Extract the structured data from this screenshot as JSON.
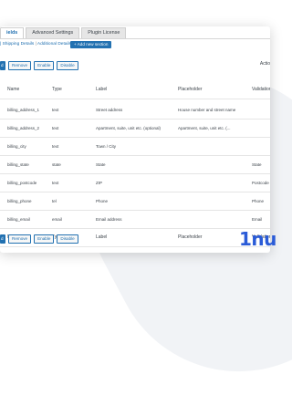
{
  "tabs": [
    {
      "label": "ields",
      "active": true
    },
    {
      "label": "Advanced Settings",
      "active": false
    },
    {
      "label": "Plugin License",
      "active": false
    }
  ],
  "subnav": {
    "shipping": "| Shipping Details",
    "sep": "|",
    "additional": "Additional Details"
  },
  "add_new": "+ Add new section",
  "toolbar": {
    "primary_label": "d",
    "remove": "Remove",
    "enable": "Enable",
    "disable": "Disable",
    "actions": "Actio"
  },
  "columns": {
    "name": "Name",
    "type": "Type",
    "label": "Label",
    "placeholder": "Placeholder",
    "validations": "Validations"
  },
  "rows": [
    {
      "name": "billing_address_1",
      "type": "text",
      "label": "Street address",
      "placeholder": "House number and street name",
      "validations": ""
    },
    {
      "name": "billing_address_2",
      "type": "text",
      "label": "Apartment, suite, unit etc. (optional)",
      "placeholder": "Apartment, suite, unit etc. (...",
      "validations": ""
    },
    {
      "name": "billing_city",
      "type": "text",
      "label": "Town / City",
      "placeholder": "",
      "validations": ""
    },
    {
      "name": "billing_state",
      "type": "state",
      "label": "State",
      "placeholder": "",
      "validations": "State"
    },
    {
      "name": "billing_postcode",
      "type": "text",
      "label": "ZIP",
      "placeholder": "",
      "validations": "Postcode"
    },
    {
      "name": "billing_phone",
      "type": "tel",
      "label": "Phone",
      "placeholder": "",
      "validations": "Phone"
    },
    {
      "name": "billing_email",
      "type": "email",
      "label": "Email address",
      "placeholder": "",
      "validations": "Email"
    }
  ],
  "brand": "1nu",
  "accent": "#2271b1"
}
